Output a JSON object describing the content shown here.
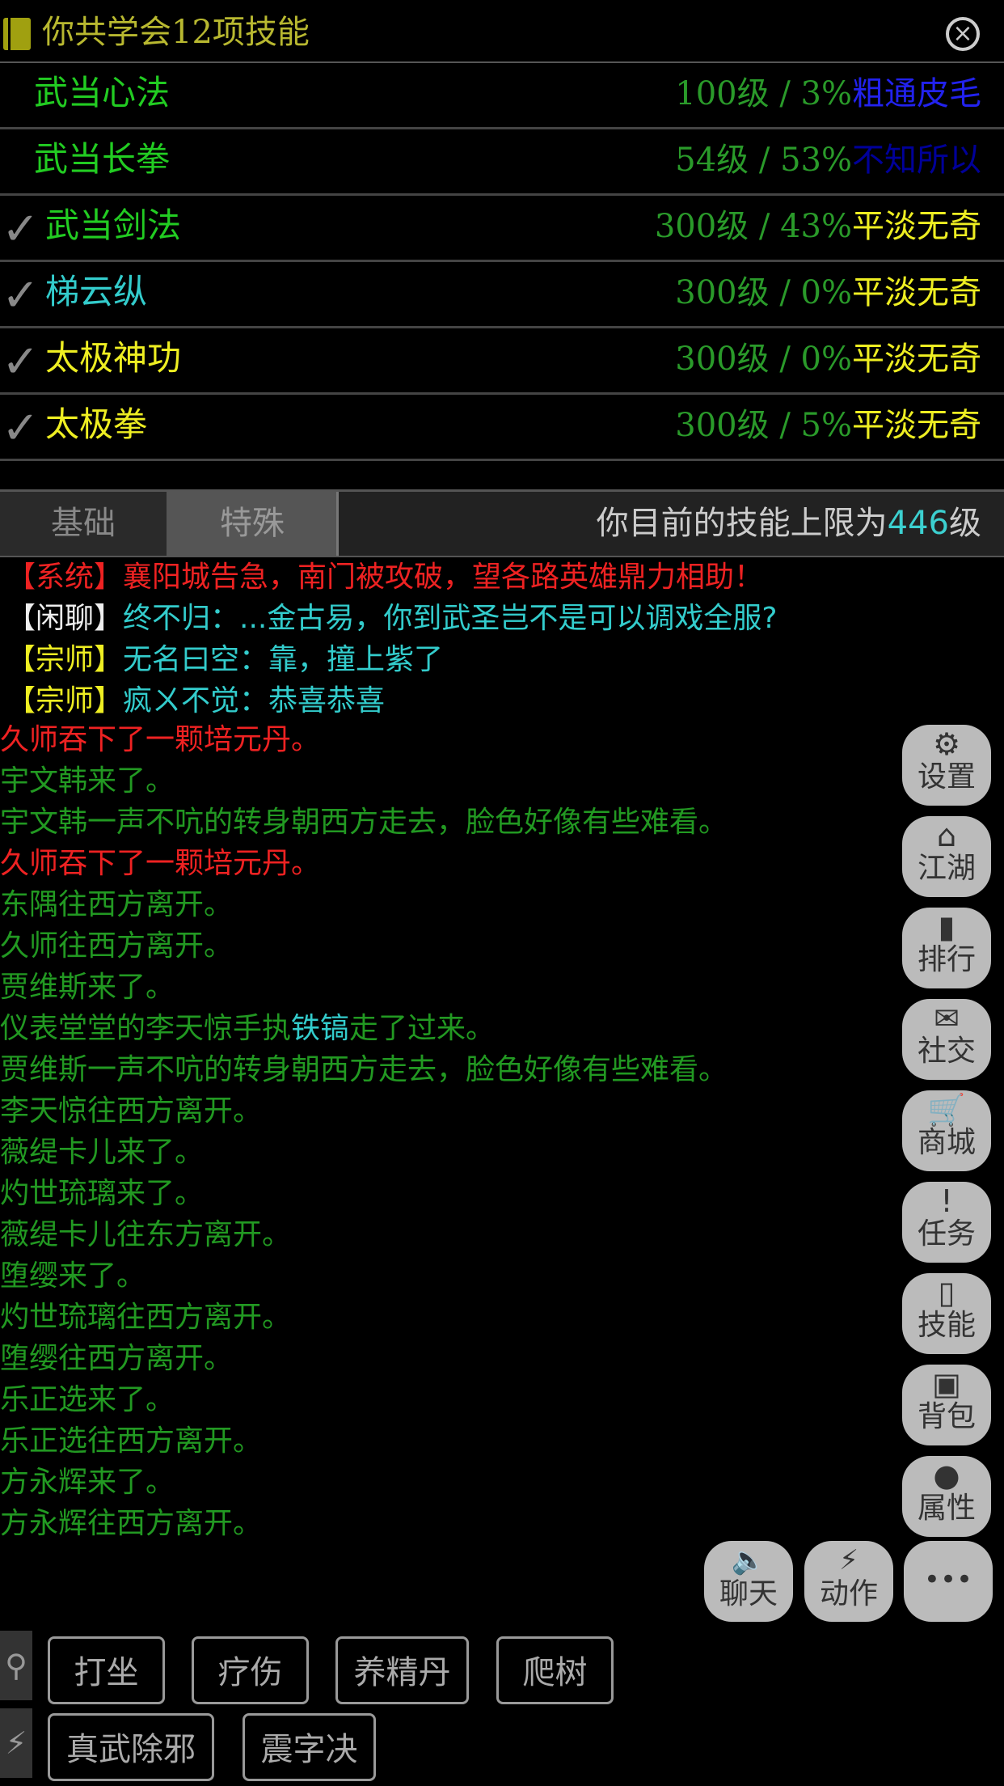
{
  "header": {
    "title": "你共学会12项技能",
    "book_icon": "book-icon",
    "close_icon": "close-icon"
  },
  "skills": [
    {
      "checked": false,
      "name": "武当心法",
      "name_color": "#22cc22",
      "level": "100级 / 3%",
      "rank": "粗通皮毛",
      "rank_color": "#2222ee"
    },
    {
      "checked": false,
      "name": "武当长拳",
      "name_color": "#22cc22",
      "level": "54级 / 53%",
      "rank": "不知所以",
      "rank_color": "#000099"
    },
    {
      "checked": true,
      "name": "武当剑法",
      "name_color": "#22cc22",
      "level": "300级 / 43%",
      "rank": "平淡无奇",
      "rank_color": "#eeee22"
    },
    {
      "checked": true,
      "name": "梯云纵",
      "name_color": "#33cccc",
      "level": "300级 / 0%",
      "rank": "平淡无奇",
      "rank_color": "#eeee22"
    },
    {
      "checked": true,
      "name": "太极神功",
      "name_color": "#eeee22",
      "level": "300级 / 0%",
      "rank": "平淡无奇",
      "rank_color": "#eeee22"
    },
    {
      "checked": true,
      "name": "太极拳",
      "name_color": "#eeee22",
      "level": "300级 / 5%",
      "rank": "平淡无奇",
      "rank_color": "#eeee22"
    }
  ],
  "check_mark": "✓",
  "tabs": {
    "basic": "基础",
    "special": "特殊"
  },
  "limit": {
    "prefix": "你目前的技能上限为",
    "value": "446",
    "suffix": "级"
  },
  "chat": [
    {
      "channel": "【系统】",
      "channel_color": "#ee2222",
      "text": "襄阳城告急，南门被攻破，望各路英雄鼎力相助！",
      "text_color": "#ee2222"
    },
    {
      "channel": "【闲聊】",
      "channel_color": "#eeeeee",
      "text": "终不归：...金古易，你到武圣岂不是可以调戏全服?",
      "text_color": "#33cccc"
    },
    {
      "channel": "【宗师】",
      "channel_color": "#eeee22",
      "text": "无名曰空：靠，撞上紫了",
      "text_color": "#33cccc"
    },
    {
      "channel": "【宗师】",
      "channel_color": "#eeee22",
      "text": "疯ㄨ不觉：恭喜恭喜",
      "text_color": "#33cccc"
    }
  ],
  "messages": [
    {
      "text": "久师吞下了一颗培元丹。",
      "color": "#ee2222"
    },
    {
      "text": "宇文韩来了。",
      "color": "#229922"
    },
    {
      "text": "宇文韩一声不吭的转身朝西方走去，脸色好像有些难看。",
      "color": "#229922"
    },
    {
      "text": "久师吞下了一颗培元丹。",
      "color": "#ee2222"
    },
    {
      "text": "东隅往西方离开。",
      "color": "#229922"
    },
    {
      "text": "久师往西方离开。",
      "color": "#229922"
    },
    {
      "text": "贾维斯来了。",
      "color": "#229922"
    },
    {
      "pre": "仪表堂堂的李天惊手执",
      "item": "铁镐",
      "post": "走了过来。",
      "color": "#229922",
      "item_color": "#33cccc"
    },
    {
      "text": "贾维斯一声不吭的转身朝西方走去，脸色好像有些难看。",
      "color": "#229922"
    },
    {
      "text": "李天惊往西方离开。",
      "color": "#229922"
    },
    {
      "text": "薇缇卡儿来了。",
      "color": "#229922"
    },
    {
      "text": "灼世琉璃来了。",
      "color": "#229922"
    },
    {
      "text": "薇缇卡儿往东方离开。",
      "color": "#229922"
    },
    {
      "text": "堕缨来了。",
      "color": "#229922"
    },
    {
      "text": "灼世琉璃往西方离开。",
      "color": "#229922"
    },
    {
      "text": "堕缨往西方离开。",
      "color": "#229922"
    },
    {
      "text": "乐正选来了。",
      "color": "#229922"
    },
    {
      "text": "乐正选往西方离开。",
      "color": "#229922"
    },
    {
      "text": "方永辉来了。",
      "color": "#229922"
    },
    {
      "text": "方永辉往西方离开。",
      "color": "#229922"
    }
  ],
  "side_menu": [
    {
      "label": "设置",
      "icon": "gear-icon",
      "glyph": "⚙"
    },
    {
      "label": "江湖",
      "icon": "home-icon",
      "glyph": "⌂"
    },
    {
      "label": "排行",
      "icon": "bar-chart-icon",
      "glyph": "▮"
    },
    {
      "label": "社交",
      "icon": "envelope-icon",
      "glyph": "✉"
    },
    {
      "label": "商城",
      "icon": "cart-icon",
      "glyph": "🛒"
    },
    {
      "label": "任务",
      "icon": "exclamation-icon",
      "glyph": "!"
    },
    {
      "label": "技能",
      "icon": "book-icon",
      "glyph": "▯"
    },
    {
      "label": "背包",
      "icon": "briefcase-icon",
      "glyph": "▣"
    },
    {
      "label": "属性",
      "icon": "person-icon",
      "glyph": "●"
    }
  ],
  "bottom_buttons": [
    {
      "label": "聊天",
      "icon": "speaker-icon",
      "glyph": "🔈"
    },
    {
      "label": "动作",
      "icon": "lightning-icon",
      "glyph": "⚡"
    },
    {
      "label": "",
      "icon": "more-icon",
      "glyph": "•••"
    }
  ],
  "quick_actions_row1": [
    "打坐",
    "疗伤",
    "养精丹",
    "爬树"
  ],
  "quick_actions_row2": [
    "真武除邪",
    "震字决"
  ],
  "row_icons": {
    "search": "search-icon",
    "skill": "lightning-icon"
  }
}
